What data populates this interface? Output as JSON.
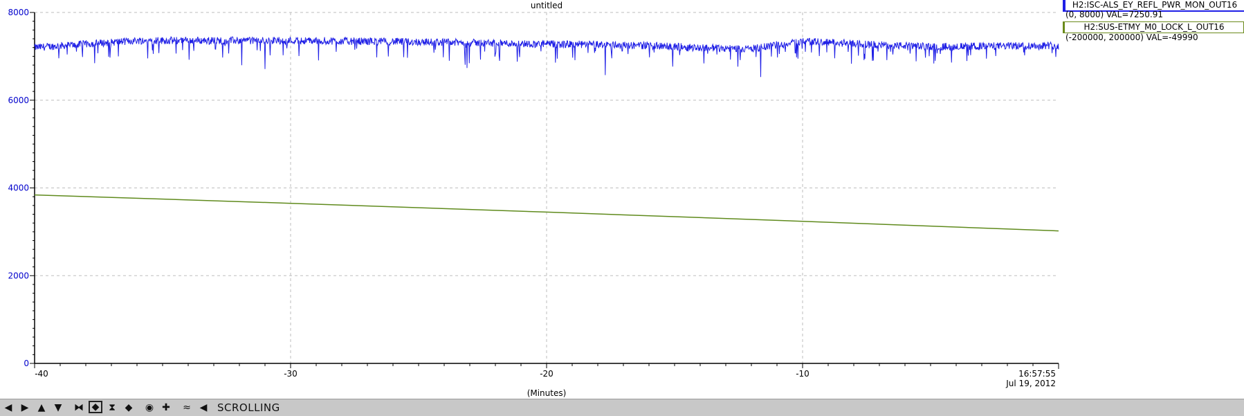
{
  "chart_data": {
    "type": "line",
    "title": "untitled",
    "xlabel": "(Minutes)",
    "xlim": [
      -40,
      0
    ],
    "ylim": [
      0,
      8000
    ],
    "y_ticks": [
      0,
      2000,
      4000,
      6000,
      8000
    ],
    "x_ticks": [
      -40,
      -30,
      -20,
      -10
    ],
    "end_label": [
      "16:57:55",
      "Jul 19, 2012"
    ],
    "grid": true,
    "series": [
      {
        "name": "H2:ISC-ALS_EY_REFL_PWR_MON_OUT16",
        "range": "(0, 8000) VAL=7250.91",
        "color": "#1f1fe6",
        "kind": "noisy",
        "x": [
          -40,
          -36,
          -30,
          -25,
          -20,
          -17,
          -14,
          -12,
          -10,
          -7,
          -5,
          0
        ],
        "y": [
          7200,
          7360,
          7360,
          7330,
          7280,
          7260,
          7200,
          7170,
          7350,
          7260,
          7220,
          7250
        ]
      },
      {
        "name": "H2:SUS-ETMY_M0_LOCK_L_OUT16",
        "range": "(-200000, 200000) VAL=-49990",
        "color": "#5f8a1c",
        "kind": "line",
        "x": [
          -40,
          -30,
          -20,
          -10,
          0
        ],
        "y": [
          3840,
          3650,
          3450,
          3240,
          3020
        ]
      }
    ]
  },
  "toolbar": {
    "icons": [
      "scroll-left-icon",
      "scroll-right-icon",
      "scroll-up-icon",
      "scroll-down-icon",
      "zoom-in-x-icon",
      "zoom-out-x-icon",
      "zoom-in-y-icon",
      "zoom-out-y-icon",
      "reset-icon",
      "add-icon",
      "autoscale-icon",
      "step-back-icon"
    ],
    "status": "SCROLLING"
  }
}
